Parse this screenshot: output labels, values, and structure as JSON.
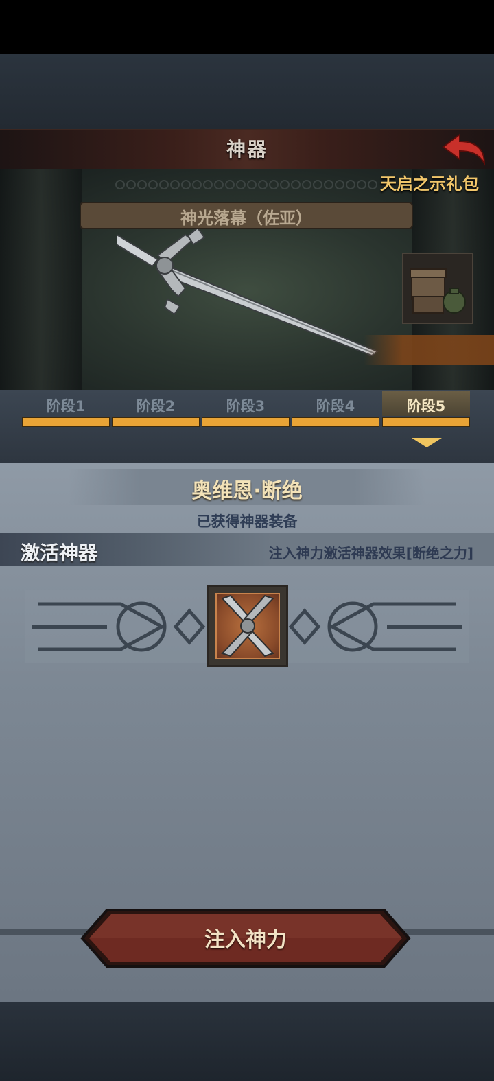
{
  "header": {
    "title": "神器"
  },
  "showcase": {
    "gift_pack_label": "天启之示礼包",
    "banner_text": "神光落幕（佐亚）"
  },
  "stages": [
    {
      "label": "阶段1"
    },
    {
      "label": "阶段2"
    },
    {
      "label": "阶段3"
    },
    {
      "label": "阶段4"
    },
    {
      "label": "阶段5"
    }
  ],
  "active_stage": "阶段5",
  "artifact": {
    "name": "奥维恩·断绝",
    "status": "已获得神器装备"
  },
  "activation": {
    "title": "激活神器",
    "description": "注入神力激活神器效果[断绝之力]"
  },
  "actions": {
    "inject_label": "注入神力"
  },
  "colors": {
    "accent_gold": "#e9a436",
    "button_red": "#6e2a22",
    "panel_gray": "#8f9aa6"
  }
}
